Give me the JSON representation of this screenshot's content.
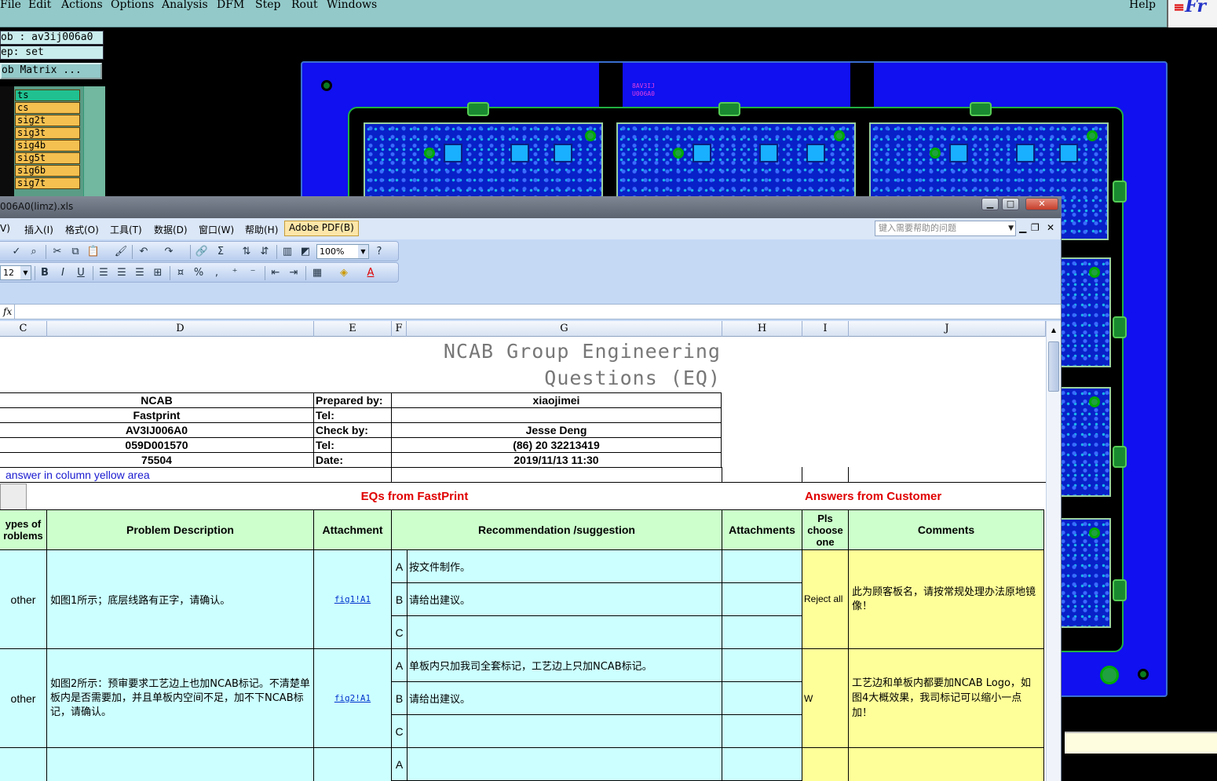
{
  "cam": {
    "menu": [
      "File",
      "Edit",
      "Actions",
      "Options",
      "Analysis",
      "DFM",
      "Step",
      "Rout",
      "Windows"
    ],
    "help": "Help",
    "logo": "Fr",
    "job_label": "ob : av3ij006a0",
    "step_label": "ep: set",
    "matrix_button": "ob Matrix ...",
    "layers": [
      "ts",
      "cs",
      "sig2t",
      "sig3t",
      "sig4b",
      "sig5t",
      "sig6b",
      "sig7t"
    ],
    "pcb_texts": [
      "8AV3IJ",
      "U006A0"
    ],
    "colors": {
      "menubar": "#93c9c9",
      "board": "#1010f0",
      "layer": "#f4c050"
    }
  },
  "excel": {
    "title": "006A0(limz).xls",
    "window_buttons": {
      "minimize": "▁",
      "maximize": "□",
      "close": "✕"
    },
    "menu": [
      "V)",
      "插入(I)",
      "格式(O)",
      "工具(T)",
      "数据(D)",
      "窗口(W)",
      "帮助(H)"
    ],
    "pdf_menu": "Adobe PDF(B)",
    "help_placeholder": "键入需要帮助的问题",
    "zoom": "100%",
    "font_size": "12",
    "fx": "fx",
    "columns": [
      "C",
      "D",
      "E",
      "F",
      "G",
      "H",
      "I",
      "J"
    ]
  },
  "sheet": {
    "title_line1": "NCAB Group Engineering",
    "title_line2": "Questions (EQ)",
    "info_values": [
      "NCAB",
      "Fastprint",
      "AV3IJ006A0",
      "059D001570",
      "75504"
    ],
    "info_labels": [
      "Prepared by:",
      "Tel:",
      "Check by:",
      "Tel:",
      "Date:"
    ],
    "info_right": [
      "xiaojimei",
      "",
      "Jesse Deng",
      "(86) 20 32213419",
      "2019/11/13 11:30"
    ],
    "note": "answer in column yellow area",
    "eq_header": "EQs from FastPrint",
    "answers_header": "Answers from Customer",
    "headers": {
      "types": "ypes of roblems",
      "problem": "Problem Description",
      "attachment": "Attachment",
      "recommendation": "Recommendation /suggestion",
      "attachments": "Attachments",
      "choose": "Pls choose one",
      "comments": "Comments"
    },
    "rows": [
      {
        "type": "other",
        "problem": "如图1所示；底层线路有正字，请确认。",
        "attachment": "fig1!A1",
        "options": [
          {
            "letter": "A",
            "text": "按文件制作。"
          },
          {
            "letter": "B",
            "text": "请给出建议。"
          },
          {
            "letter": "C",
            "text": ""
          }
        ],
        "choice": "Reject all",
        "comment": "此为顾客板名，请按常规处理办法原地镜像！"
      },
      {
        "type": "other",
        "problem": "如图2所示：预审要求工艺边上也加NCAB标记。不清楚单板内是否需要加，并且单板内空间不足，加不下NCAB标记，请确认。",
        "attachment": "fig2!A1",
        "options": [
          {
            "letter": "A",
            "text": "单板内只加我司全套标记，工艺边上只加NCAB标记。"
          },
          {
            "letter": "B",
            "text": "请给出建议。"
          },
          {
            "letter": "C",
            "text": ""
          }
        ],
        "choice": "W",
        "comment": "工艺边和单板内都要加NCAB Logo，如图4大概效果，我司标记可以缩小一点加！"
      },
      {
        "type": "",
        "problem": "",
        "attachment": "",
        "options": [
          {
            "letter": "A",
            "text": ""
          }
        ],
        "choice": "",
        "comment": ""
      }
    ]
  }
}
